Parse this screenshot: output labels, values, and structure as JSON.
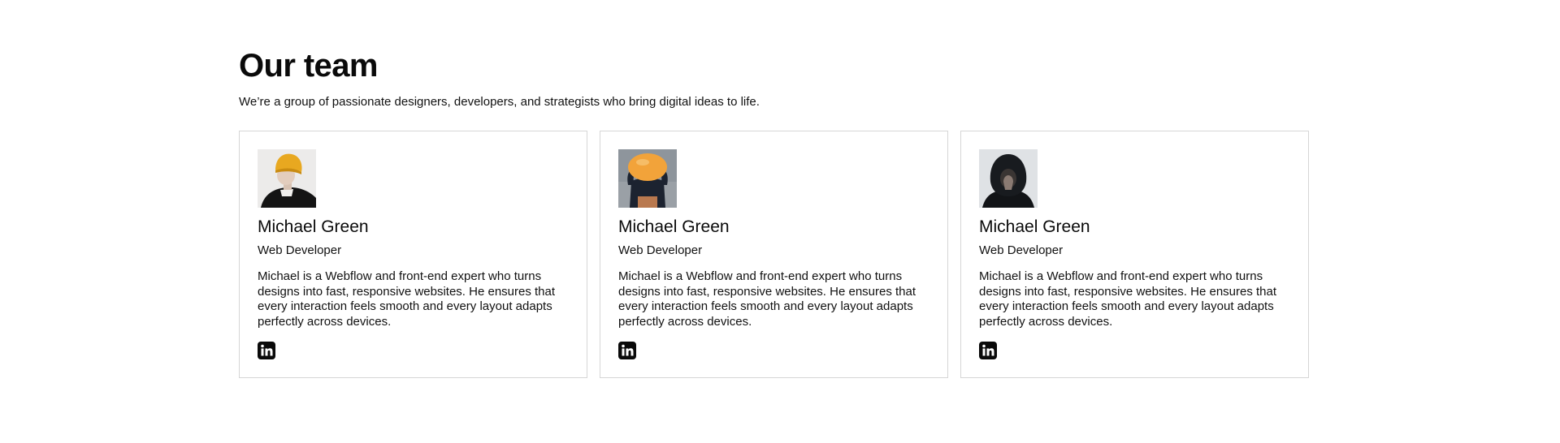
{
  "section": {
    "title": "Our team",
    "subtitle": "We’re a group of passionate designers, developers, and strategists who bring digital ideas to life."
  },
  "members": [
    {
      "name": "Michael Green",
      "role": "Web Developer",
      "bio": "Michael is a Webflow and front-end expert who turns designs into fast, responsive websites. He ensures that every interaction feels smooth and every layout adapts perfectly across devices.",
      "social_icon": "linkedin-icon"
    },
    {
      "name": "Michael Green",
      "role": "Web Developer",
      "bio": "Michael is a Webflow and front-end expert who turns designs into fast, responsive websites. He ensures that every interaction feels smooth and every layout adapts perfectly across devices.",
      "social_icon": "linkedin-icon"
    },
    {
      "name": "Michael Green",
      "role": "Web Developer",
      "bio": "Michael is a Webflow and front-end expert who turns designs into fast, responsive websites. He ensures that every interaction feels smooth and every layout adapts perfectly across devices.",
      "social_icon": "linkedin-icon"
    }
  ],
  "colors": {
    "text": "#0a0a0a",
    "card_border": "#d6d6d6",
    "background": "#ffffff",
    "beanie_yellow": "#e8a820",
    "balloon_orange": "#f2a33a"
  }
}
